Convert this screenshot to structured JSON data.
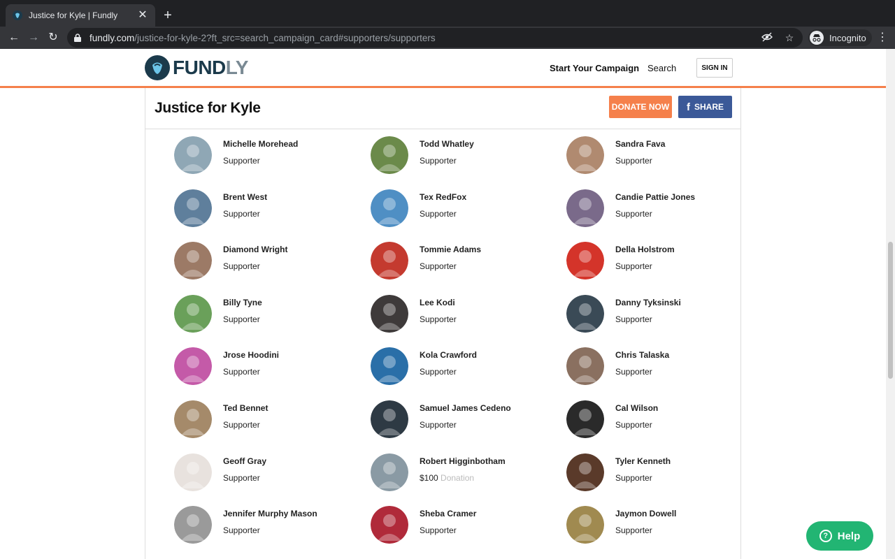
{
  "browser": {
    "tab_title": "Justice for Kyle | Fundly",
    "tab_close": "✕",
    "new_tab": "+",
    "url_host": "fundly.com",
    "url_path": "/justice-for-kyle-2?ft_src=search_campaign_card#supporters/supporters",
    "incognito_label": "Incognito",
    "back": "←",
    "forward": "→",
    "reload": "↻",
    "menu": "⋮",
    "eye_off": "◌",
    "star": "☆"
  },
  "header": {
    "logo_main": "FUND",
    "logo_tail": "LY",
    "start_campaign": "Start Your Campaign",
    "search": "Search",
    "sign_in": "SIGN IN"
  },
  "campaign": {
    "title": "Justice for Kyle",
    "donate_label": "DONATE NOW",
    "share_label": "SHARE",
    "share_icon": "f"
  },
  "supporters": [
    {
      "name": "Michelle Morehead",
      "role": "Supporter",
      "color": "#8fa7b5"
    },
    {
      "name": "Todd Whatley",
      "role": "Supporter",
      "color": "#6b8a4a"
    },
    {
      "name": "Sandra Fava",
      "role": "Supporter",
      "color": "#b08a70"
    },
    {
      "name": "Brent West",
      "role": "Supporter",
      "color": "#5f7f9c"
    },
    {
      "name": "Tex RedFox",
      "role": "Supporter",
      "color": "#4f8fc4"
    },
    {
      "name": "Candie Pattie Jones",
      "role": "Supporter",
      "color": "#7a6a8a"
    },
    {
      "name": "Diamond Wright",
      "role": "Supporter",
      "color": "#9c7a66"
    },
    {
      "name": "Tommie Adams",
      "role": "Supporter",
      "color": "#c43a2f"
    },
    {
      "name": "Della Holstrom",
      "role": "Supporter",
      "color": "#d4342a"
    },
    {
      "name": "Billy Tyne",
      "role": "Supporter",
      "color": "#6aa05a"
    },
    {
      "name": "Lee Kodi",
      "role": "Supporter",
      "color": "#3e3a3a"
    },
    {
      "name": "Danny Tyksinski",
      "role": "Supporter",
      "color": "#3a4a56"
    },
    {
      "name": "Jrose Hoodini",
      "role": "Supporter",
      "color": "#c45aa8"
    },
    {
      "name": "Kola Crawford",
      "role": "Supporter",
      "color": "#2a6fa8"
    },
    {
      "name": "Chris Talaska",
      "role": "Supporter",
      "color": "#8a7060"
    },
    {
      "name": "Ted Bennet",
      "role": "Supporter",
      "color": "#a58a6a"
    },
    {
      "name": "Samuel James Cedeno",
      "role": "Supporter",
      "color": "#2e3a44"
    },
    {
      "name": "Cal Wilson",
      "role": "Supporter",
      "color": "#2a2a2a"
    },
    {
      "name": "Geoff Gray",
      "role": "Supporter",
      "color": "#e8e2de"
    },
    {
      "name": "Robert Higginbotham",
      "role": "$100",
      "extra": "Donation",
      "color": "#8a9aa4"
    },
    {
      "name": "Tyler Kenneth",
      "role": "Supporter",
      "color": "#5a3a2a"
    },
    {
      "name": "Jennifer Murphy Mason",
      "role": "Supporter",
      "color": "#9a9a9a"
    },
    {
      "name": "Sheba Cramer",
      "role": "Supporter",
      "color": "#b02a3a"
    },
    {
      "name": "Jaymon Dowell",
      "role": "Supporter",
      "color": "#a08a50"
    }
  ],
  "help": {
    "label": "Help",
    "icon": "?"
  }
}
